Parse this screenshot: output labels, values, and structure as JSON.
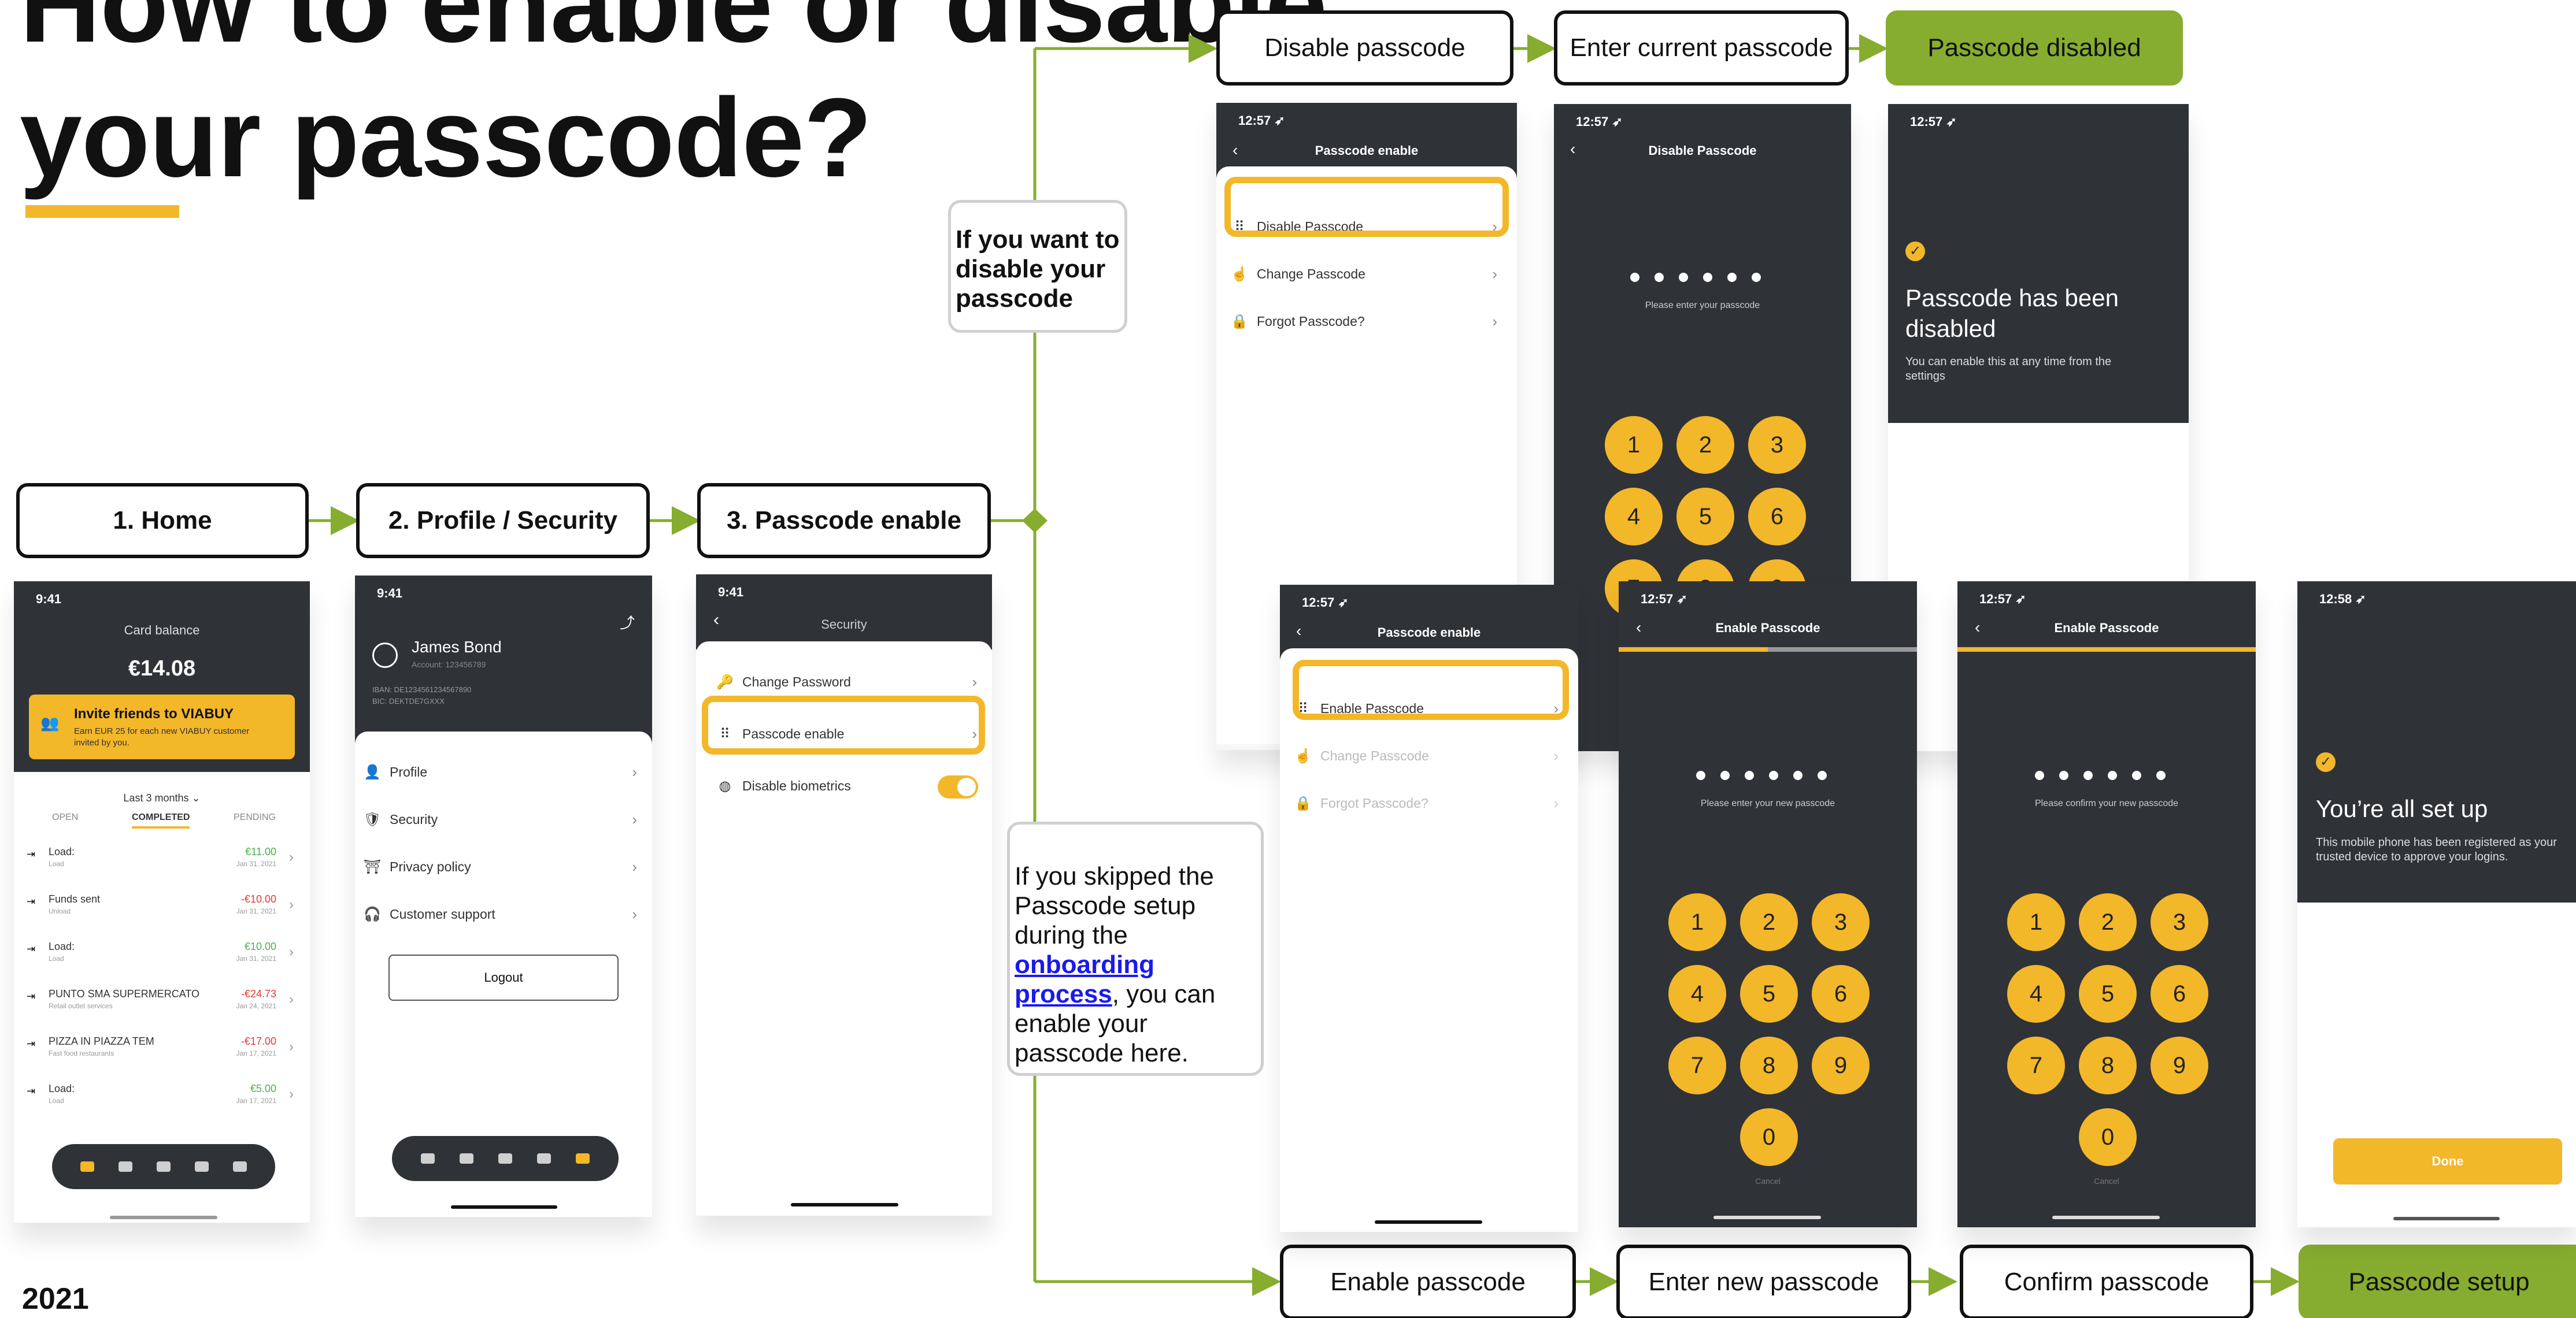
{
  "title": {
    "line1": "How to enable or disable",
    "line2": "your passcode?"
  },
  "year": "2021",
  "steps": {
    "home": "1. Home",
    "profile_security": "2. Profile / Security",
    "passcode_enable": "3. Passcode enable",
    "disable_passcode": "Disable passcode",
    "enter_current": "Enter current passcode",
    "passcode_disabled": "Passcode disabled",
    "enable_passcode": "Enable passcode",
    "enter_new": "Enter new passcode",
    "confirm_passcode": "Confirm passcode",
    "passcode_setup": "Passcode setup"
  },
  "notes": {
    "disable": "If you want to disable your passcode",
    "skipped_pre": "If you skipped the Passcode setup during the ",
    "skipped_link": "onboarding process",
    "skipped_post": ", you can enable your passcode here."
  },
  "colors": {
    "accent": "#f3b72a",
    "green": "#86ad2f",
    "dark": "#2f3237"
  },
  "home_screen": {
    "time": "9:41",
    "card_balance": "Card balance",
    "amount": "€14.08",
    "invite_title": "Invite friends to VIABUY",
    "invite_text": "Earn EUR 25 for each new VIABUY customer invited by you.",
    "filter": "Last 3 months",
    "tabs": [
      "OPEN",
      "COMPLETED",
      "PENDING"
    ],
    "transactions": [
      {
        "name": "Load:",
        "sub": "Load",
        "amount": "€11.00",
        "date": "Jan 31, 2021",
        "color": "#4caf50"
      },
      {
        "name": "Funds sent",
        "sub": "Unload",
        "amount": "-€10.00",
        "date": "Jan 31, 2021",
        "color": "#e53935"
      },
      {
        "name": "Load:",
        "sub": "Load",
        "amount": "€10.00",
        "date": "Jan 31, 2021",
        "color": "#4caf50"
      },
      {
        "name": "PUNTO SMA SUPERMERCATO",
        "sub": "Retail outlet services",
        "amount": "-€24.73",
        "date": "Jan 24, 2021",
        "color": "#e53935"
      },
      {
        "name": "PIZZA IN PIAZZA TEM",
        "sub": "Fast food restaurants",
        "amount": "-€17.00",
        "date": "Jan 17, 2021",
        "color": "#e53935"
      },
      {
        "name": "Load:",
        "sub": "Load",
        "amount": "€5.00",
        "date": "Jan 17, 2021",
        "color": "#4caf50"
      }
    ]
  },
  "profile_screen": {
    "time": "9:41",
    "name": "James Bond",
    "account": "Account: 123456789",
    "iban": "IBAN: DE1234561234567890",
    "bic": "BIC: DEKTDE7GXXX",
    "menu": [
      "Profile",
      "Security",
      "Privacy policy",
      "Customer support"
    ],
    "logout": "Logout"
  },
  "security_screen": {
    "time": "9:41",
    "title": "Security",
    "items": [
      "Change Password",
      "Passcode enable",
      "Disable biometrics"
    ]
  },
  "disable_menu_screen": {
    "time": "12:57",
    "title": "Passcode enable",
    "items": [
      "Disable Passcode",
      "Change Passcode",
      "Forgot Passcode?"
    ]
  },
  "disable_entry_screen": {
    "time": "12:57",
    "title": "Disable Passcode",
    "prompt": "Please enter your passcode",
    "keys": [
      "1",
      "2",
      "3",
      "4",
      "5",
      "6",
      "7",
      "8",
      "9"
    ]
  },
  "disabled_screen": {
    "time": "12:57",
    "heading": "Passcode has been disabled",
    "text": "You can enable this at any time from the settings"
  },
  "enable_menu_screen": {
    "time": "12:57",
    "title": "Passcode enable",
    "items": [
      "Enable Passcode",
      "Change Passcode",
      "Forgot Passcode?"
    ]
  },
  "enable_new_screen": {
    "time": "12:57",
    "title": "Enable Passcode",
    "prompt": "Please enter your new passcode",
    "keys": [
      "1",
      "2",
      "3",
      "4",
      "5",
      "6",
      "7",
      "8",
      "9",
      "0"
    ],
    "cancel": "Cancel"
  },
  "enable_confirm_screen": {
    "time": "12:57",
    "title": "Enable Passcode",
    "prompt": "Please confirm your new passcode",
    "keys": [
      "1",
      "2",
      "3",
      "4",
      "5",
      "6",
      "7",
      "8",
      "9",
      "0"
    ],
    "cancel": "Cancel"
  },
  "setup_screen": {
    "time": "12:58",
    "heading": "You’re all set up",
    "text": "This mobile phone has been registered as your trusted device to approve your logins.",
    "done": "Done"
  }
}
